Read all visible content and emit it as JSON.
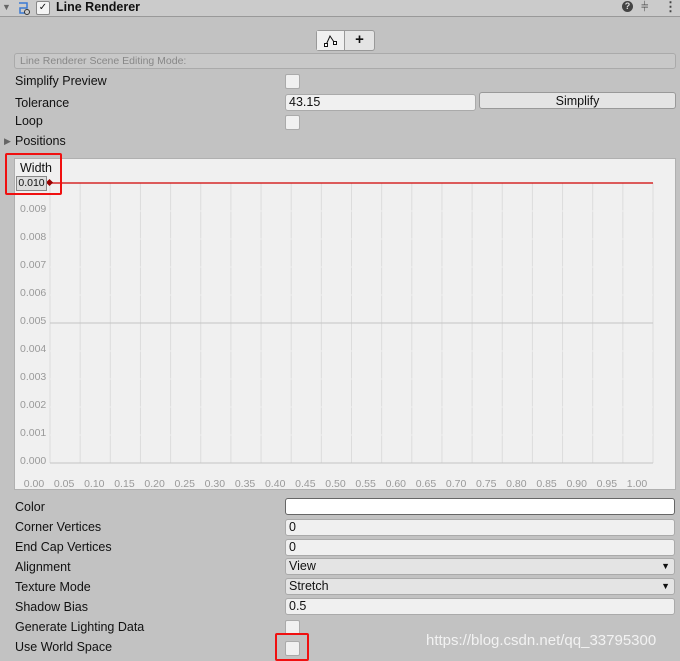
{
  "header": {
    "title": "Line Renderer",
    "enabled": true,
    "icons": [
      "foldout-arrow-icon",
      "line-renderer-icon",
      "help-icon",
      "preset-icon",
      "kebab-menu-icon"
    ]
  },
  "edit_toolbar": {
    "edit_points_icon": "edit-points-icon",
    "add_label": "+"
  },
  "scene_editing_mode": "Line Renderer Scene Editing Mode:",
  "simplify_preview": {
    "label": "Simplify Preview",
    "checked": false
  },
  "tolerance": {
    "label": "Tolerance",
    "value": "43.15",
    "button": "Simplify"
  },
  "loop": {
    "label": "Loop",
    "checked": false
  },
  "positions": {
    "label": "Positions"
  },
  "width_curve": {
    "label": "Width",
    "value_box": "0.010",
    "curve_color": "#d00000"
  },
  "chart_data": {
    "type": "line",
    "title": "Width",
    "x": [
      0.0,
      1.0
    ],
    "y": [
      0.01,
      0.01
    ],
    "xlim": [
      0,
      1
    ],
    "ylim": [
      0,
      0.01
    ],
    "grid": true,
    "y_ticks": [
      "0.010",
      "0.009",
      "0.008",
      "0.007",
      "0.006",
      "0.005",
      "0.004",
      "0.003",
      "0.002",
      "0.001",
      "0.000"
    ],
    "x_ticks": [
      "0.00",
      "0.05",
      "0.10",
      "0.15",
      "0.20",
      "0.25",
      "0.30",
      "0.35",
      "0.40",
      "0.45",
      "0.50",
      "0.55",
      "0.60",
      "0.65",
      "0.70",
      "0.75",
      "0.80",
      "0.85",
      "0.90",
      "0.95",
      "1.00"
    ]
  },
  "color": {
    "label": "Color",
    "value": "#ffffff"
  },
  "corner_vertices": {
    "label": "Corner Vertices",
    "value": "0"
  },
  "end_cap_vertices": {
    "label": "End Cap Vertices",
    "value": "0"
  },
  "alignment": {
    "label": "Alignment",
    "value": "View"
  },
  "texture_mode": {
    "label": "Texture Mode",
    "value": "Stretch"
  },
  "shadow_bias": {
    "label": "Shadow Bias",
    "value": "0.5"
  },
  "generate_lighting_data": {
    "label": "Generate Lighting Data",
    "checked": false
  },
  "use_world_space": {
    "label": "Use World Space",
    "checked": false
  },
  "watermark": "https://blog.csdn.net/qq_33795300",
  "highlight_color": "#f01010"
}
